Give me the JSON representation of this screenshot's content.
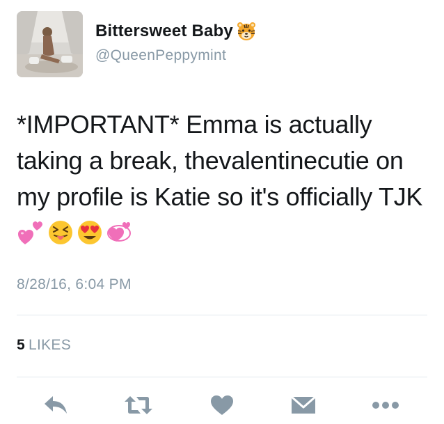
{
  "user": {
    "display_name": "Bittersweet Baby",
    "badge_icon": "tiger-face-emoji",
    "handle": "@QueenPeppymint"
  },
  "tweet": {
    "text": "*IMPORTANT* Emma is actually taking a break, thevalentinecutie on my profile is Katie so it's officially TJK",
    "emojis": [
      "two-hearts-emoji",
      "squinting-tongue-face-emoji",
      "heart-eyes-face-emoji",
      "revolving-hearts-emoji"
    ],
    "timestamp": "8/28/16, 6:04 PM"
  },
  "stats": {
    "likes_count": "5",
    "likes_label": "LIKES"
  },
  "actions": [
    {
      "name": "reply",
      "icon": "reply-icon"
    },
    {
      "name": "retweet",
      "icon": "retweet-icon"
    },
    {
      "name": "like",
      "icon": "heart-icon"
    },
    {
      "name": "direct-message",
      "icon": "envelope-icon"
    },
    {
      "name": "more",
      "icon": "more-dots-icon"
    }
  ],
  "colors": {
    "text": "#14171a",
    "secondary": "#8899a6",
    "divider": "#e1e8ed",
    "action_icon": "#8899a6"
  }
}
